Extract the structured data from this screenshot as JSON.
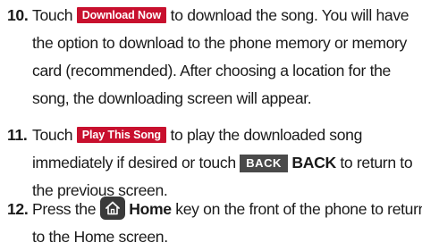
{
  "steps": [
    {
      "number": "10.",
      "lines": [
        {
          "pre": "Touch ",
          "button": "Download Now",
          "post": " to download the song. You will have"
        },
        {
          "text": "the option to download to the phone memory or memory"
        },
        {
          "text": "card (recommended). After choosing a location for the"
        },
        {
          "text": "song, the downloading screen will appear."
        }
      ]
    },
    {
      "number": "11.",
      "lines": [
        {
          "pre": "Touch ",
          "button": "Play This Song",
          "post": " to play the downloaded song"
        },
        {
          "pre": "immediately if desired or touch ",
          "button": "BACK",
          "bold": "BACK",
          "post": " to return to"
        },
        {
          "text": "the previous screen."
        }
      ]
    },
    {
      "number": "12.",
      "lines": [
        {
          "pre": "Press the ",
          "icon": "home-icon",
          "bold": "Home",
          "post": " key on the front of the phone to return"
        },
        {
          "text": "to the Home screen."
        }
      ]
    }
  ],
  "colors": {
    "button_red": "#c8102e",
    "back_key": "#4a4a4a",
    "home_key": "#3a3a3a"
  }
}
